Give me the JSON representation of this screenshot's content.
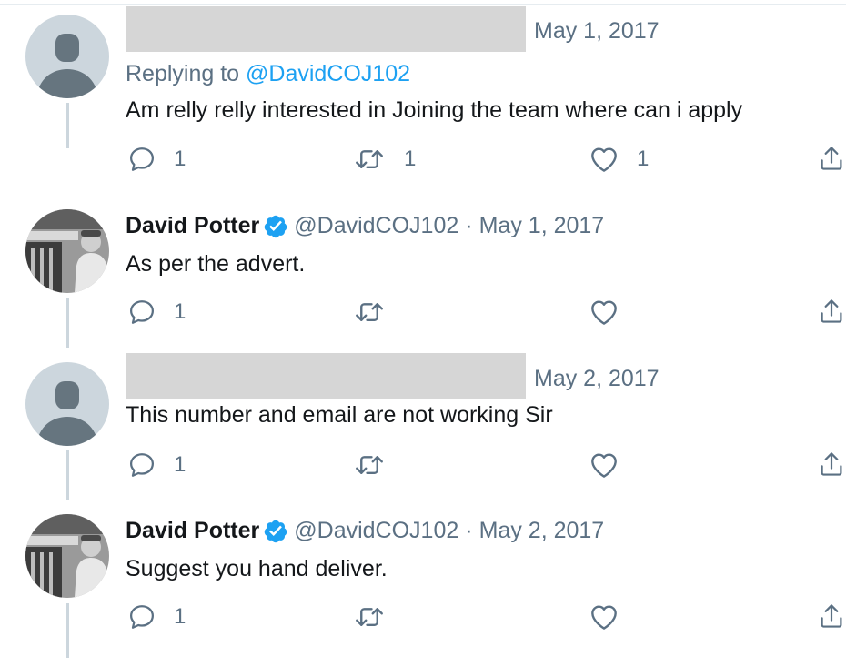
{
  "tweets": [
    {
      "type": "redacted",
      "date": "May 1, 2017",
      "replying_prefix": "Replying to ",
      "replying_handle": "@DavidCOJ102",
      "text": "Am relly relly interested in Joining the team where can i apply",
      "reply_count": "1",
      "retweet_count": "1",
      "like_count": "1"
    },
    {
      "type": "author",
      "name": "David Potter",
      "handle": "@DavidCOJ102",
      "separator": "·",
      "date": "May 1, 2017",
      "text": "As per the advert.",
      "reply_count": "1",
      "retweet_count": "",
      "like_count": ""
    },
    {
      "type": "redacted",
      "date": "May 2, 2017",
      "text": "This number and email are not working Sir",
      "reply_count": "1",
      "retweet_count": "",
      "like_count": ""
    },
    {
      "type": "author",
      "name": "David Potter",
      "handle": "@DavidCOJ102",
      "separator": "·",
      "date": "May 2, 2017",
      "text": "Suggest you hand deliver.",
      "reply_count": "1",
      "retweet_count": "",
      "like_count": ""
    }
  ],
  "colors": {
    "accent": "#1da1f2",
    "secondary_text": "#5b7083",
    "primary_text": "#14171a",
    "thread_line": "#ccd6dd",
    "redaction": "#d6d6d6",
    "default_avatar_bg": "#ccd6dd",
    "default_avatar_fg": "#66757f"
  },
  "icons": [
    "reply-icon",
    "retweet-icon",
    "like-icon",
    "share-icon",
    "verified-badge-icon",
    "default-avatar-icon"
  ]
}
